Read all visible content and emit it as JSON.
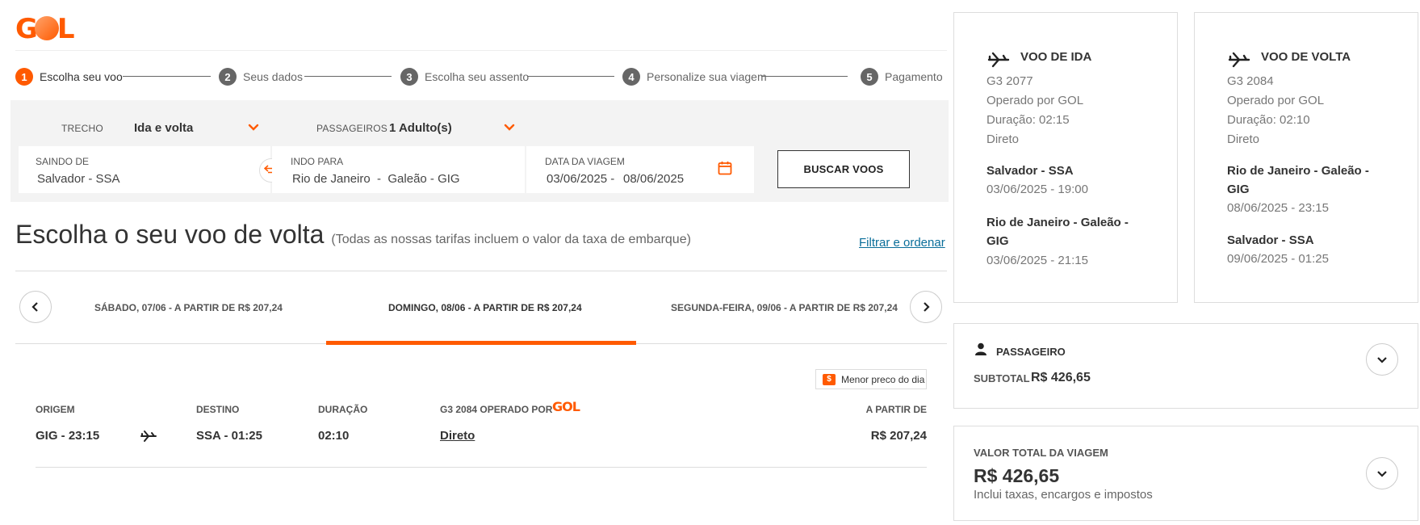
{
  "brand": {
    "logo_text": "GOL",
    "accent_color": "#ff5a00"
  },
  "stepper": [
    {
      "num": "1",
      "label": "Escolha seu voo",
      "active": true
    },
    {
      "num": "2",
      "label": "Seus dados"
    },
    {
      "num": "3",
      "label": "Escolha seu assento"
    },
    {
      "num": "4",
      "label": "Personalize sua viagem"
    },
    {
      "num": "5",
      "label": "Pagamento"
    }
  ],
  "search": {
    "trecho_label": "TRECHO",
    "trecho_value": "Ida e volta",
    "passageiros_label": "PASSAGEIROS",
    "passageiros_value": "1 Adulto(s)",
    "origin_label": "SAINDO DE",
    "origin_value": "Salvador - SSA",
    "dest_label": "INDO PARA",
    "dest_value": "Rio de Janeiro  -  Galeão - GIG",
    "date_label": "DATA DA VIAGEM",
    "date_from": "03/06/2025 -",
    "date_to": "08/06/2025",
    "button_label": "BUSCAR VOOS"
  },
  "heading": {
    "title": "Escolha o seu voo de volta",
    "subtitle": "(Todas as nossas tarifas incluem o valor da taxa de embarque)",
    "filter_link": "Filtrar e ordenar"
  },
  "date_tabs": [
    {
      "label": "SÁBADO, 07/06 - A PARTIR DE R$ 207,24"
    },
    {
      "label": "DOMINGO, 08/06 - A PARTIR DE R$ 207,24",
      "active": true
    },
    {
      "label": "SEGUNDA-FEIRA, 09/06 - A PARTIR DE R$ 207,24"
    }
  ],
  "badge": {
    "icon": "$",
    "label": "Menor preco do dia"
  },
  "flight": {
    "origin_h": "ORIGEM",
    "origin_v": "GIG - 23:15",
    "dest_h": "DESTINO",
    "dest_v": "SSA - 01:25",
    "dur_h": "DURAÇÃO",
    "dur_v": "02:10",
    "op_h": "G3 2084 OPERADO POR",
    "op_logo": "GOL",
    "op_v": "Direto",
    "price_h": "A PARTIR DE",
    "price_v": "R$ 207,24"
  },
  "outbound": {
    "title": "VOO DE IDA",
    "flight_no": "G3 2077",
    "operated": "Operado por GOL",
    "duration": "Duração: 02:15",
    "type": "Direto",
    "from_city": "Salvador - SSA",
    "from_time": "03/06/2025 - 19:00",
    "to_city": "Rio de Janeiro - Galeão - GIG",
    "to_time": "03/06/2025 - 21:15"
  },
  "return": {
    "title": "VOO DE VOLTA",
    "flight_no": "G3 2084",
    "operated": "Operado por GOL",
    "duration": "Duração: 02:10",
    "type": "Direto",
    "from_city": "Rio de Janeiro - Galeão - GIG",
    "from_time": "08/06/2025 - 23:15",
    "to_city": "Salvador - SSA",
    "to_time": "09/06/2025 - 01:25"
  },
  "passenger": {
    "title": "PASSAGEIRO",
    "subtotal_label": "SUBTOTAL",
    "subtotal_value": "R$ 426,65"
  },
  "total": {
    "title": "VALOR TOTAL DA VIAGEM",
    "value": "R$ 426,65",
    "note": "Inclui taxas, encargos e impostos"
  }
}
